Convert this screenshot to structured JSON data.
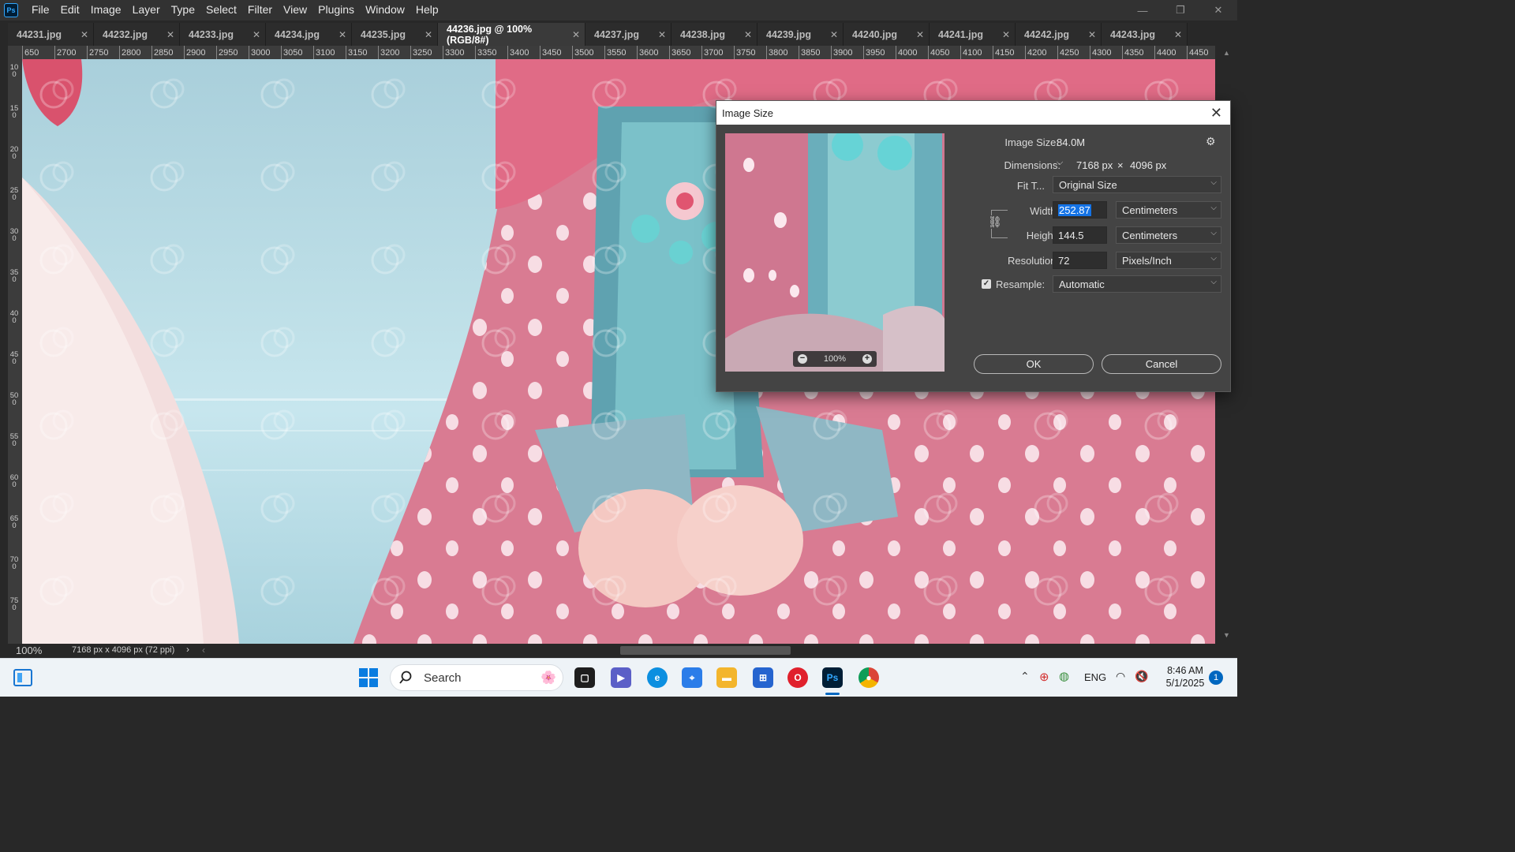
{
  "app": {
    "logo": "Ps",
    "menu": [
      "File",
      "Edit",
      "Image",
      "Layer",
      "Type",
      "Select",
      "Filter",
      "View",
      "Plugins",
      "Window",
      "Help"
    ]
  },
  "tabs": [
    {
      "label": "44231.jpg",
      "active": false
    },
    {
      "label": "44232.jpg",
      "active": false
    },
    {
      "label": "44233.jpg",
      "active": false
    },
    {
      "label": "44234.jpg",
      "active": false
    },
    {
      "label": "44235.jpg",
      "active": false
    },
    {
      "label": "44236.jpg @ 100% (RGB/8#)",
      "active": true
    },
    {
      "label": "44237.jpg",
      "active": false
    },
    {
      "label": "44238.jpg",
      "active": false
    },
    {
      "label": "44239.jpg",
      "active": false
    },
    {
      "label": "44240.jpg",
      "active": false
    },
    {
      "label": "44241.jpg",
      "active": false
    },
    {
      "label": "44242.jpg",
      "active": false
    },
    {
      "label": "44243.jpg",
      "active": false
    }
  ],
  "ruler": {
    "h_labels": [
      "650",
      "2700",
      "2750",
      "2800",
      "2850",
      "2900",
      "2950",
      "3000",
      "3050",
      "3100",
      "3150",
      "3200",
      "3250",
      "3300",
      "3350",
      "3400",
      "3450",
      "3500",
      "3550",
      "3600",
      "3650",
      "3700",
      "3750",
      "3800",
      "3850",
      "3900",
      "3950",
      "4000",
      "4050",
      "4100",
      "4150",
      "4200",
      "4250",
      "4300",
      "4350",
      "4400",
      "4450",
      "4"
    ],
    "v_labels": [
      "100",
      "150",
      "200",
      "250",
      "300",
      "350",
      "400",
      "450",
      "500",
      "550",
      "600",
      "650",
      "700",
      "750"
    ]
  },
  "status": {
    "zoom": "100%",
    "doc_info": "7168 px x 4096 px (72 ppi)",
    "arrow": "›"
  },
  "dialog": {
    "title": "Image Size",
    "close": "✕",
    "preview_zoom": "100%",
    "image_size_label": "Image Size:",
    "image_size_value": "84.0M",
    "dimensions_label": "Dimensions:",
    "dim_width": "7168 px",
    "dim_x": "×",
    "dim_height": "4096 px",
    "fit_label": "Fit T...",
    "fit_value": "Original Size",
    "width_label": "Width:",
    "width_value": "252.87",
    "width_unit": "Centimeters",
    "height_label": "Height:",
    "height_value": "144.5",
    "height_unit": "Centimeters",
    "resolution_label": "Resolution:",
    "resolution_value": "72",
    "resolution_unit": "Pixels/Inch",
    "resample_label": "Resample:",
    "resample_checked": true,
    "resample_value": "Automatic",
    "ok_label": "OK",
    "cancel_label": "Cancel"
  },
  "taskbar": {
    "search_placeholder": "Search",
    "language": "ENG",
    "time": "8:46 AM",
    "date": "5/1/2025",
    "notification_count": "1"
  },
  "colors": {
    "accent": "#1473e6",
    "ps_blue": "#31a8ff",
    "dialog_bg": "#444444"
  }
}
